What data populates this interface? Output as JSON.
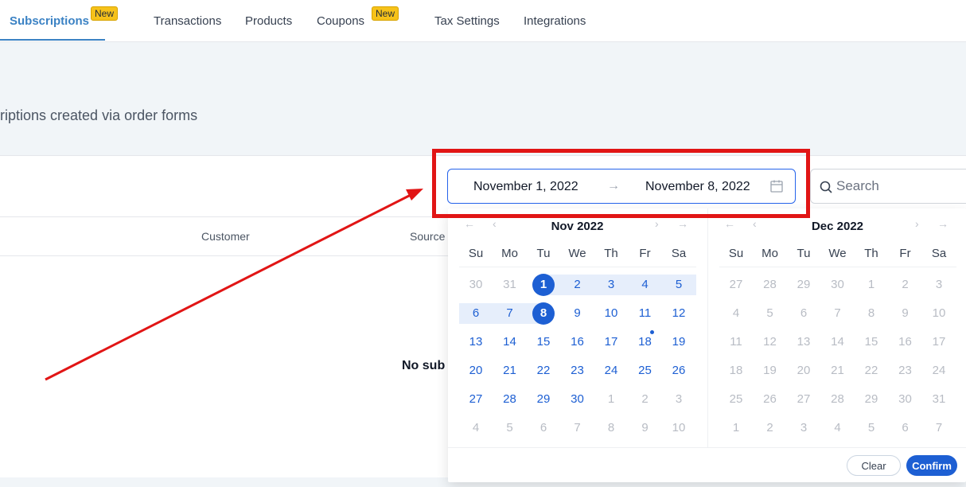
{
  "nav": {
    "tabs": [
      {
        "label": "Subscriptions",
        "badge": "New",
        "active": true
      },
      {
        "label": "Transactions"
      },
      {
        "label": "Products"
      },
      {
        "label": "Coupons",
        "badge": "New"
      },
      {
        "label": "Tax Settings"
      },
      {
        "label": "Integrations"
      }
    ]
  },
  "page": {
    "subtitle": "riptions created via order forms",
    "columns": [
      "Customer",
      "Source"
    ],
    "empty_text": "No sub"
  },
  "date_range": {
    "start": "November 1, 2022",
    "arrow": "→",
    "end": "November 8, 2022"
  },
  "search": {
    "placeholder": "Search"
  },
  "calendar": {
    "weekdays": [
      "Su",
      "Mo",
      "Tu",
      "We",
      "Th",
      "Fr",
      "Sa"
    ],
    "left": {
      "title": "Nov 2022",
      "weeks": [
        [
          "30",
          "31",
          "1",
          "2",
          "3",
          "4",
          "5"
        ],
        [
          "6",
          "7",
          "8",
          "9",
          "10",
          "11",
          "12"
        ],
        [
          "13",
          "14",
          "15",
          "16",
          "17",
          "18",
          "19"
        ],
        [
          "20",
          "21",
          "22",
          "23",
          "24",
          "25",
          "26"
        ],
        [
          "27",
          "28",
          "29",
          "30",
          "1",
          "2",
          "3"
        ],
        [
          "4",
          "5",
          "6",
          "7",
          "8",
          "9",
          "10"
        ]
      ]
    },
    "right": {
      "title": "Dec 2022",
      "weeks": [
        [
          "27",
          "28",
          "29",
          "30",
          "1",
          "2",
          "3"
        ],
        [
          "4",
          "5",
          "6",
          "7",
          "8",
          "9",
          "10"
        ],
        [
          "11",
          "12",
          "13",
          "14",
          "15",
          "16",
          "17"
        ],
        [
          "18",
          "19",
          "20",
          "21",
          "22",
          "23",
          "24"
        ],
        [
          "25",
          "26",
          "27",
          "28",
          "29",
          "30",
          "31"
        ],
        [
          "1",
          "2",
          "3",
          "4",
          "5",
          "6",
          "7"
        ]
      ]
    },
    "selected_start": "1",
    "selected_end": "8",
    "today": "18",
    "clear_label": "Clear",
    "confirm_label": "Confirm"
  },
  "colors": {
    "accent": "#1d5fd3",
    "annotation": "#e11515",
    "badge": "#f6c21a"
  }
}
